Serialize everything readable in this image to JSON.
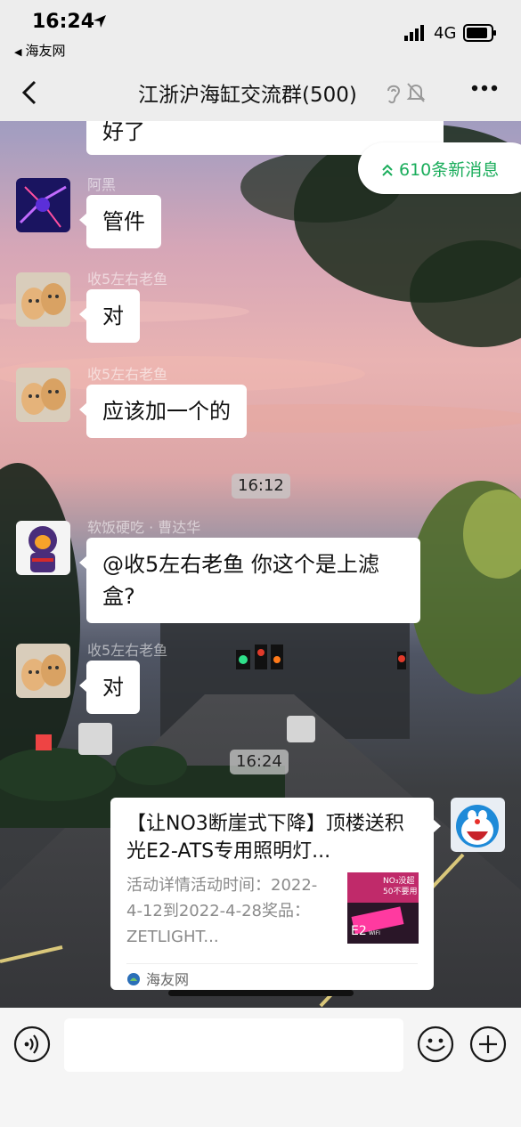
{
  "status": {
    "time": "16:24",
    "back_app": "海友网",
    "network": "4G"
  },
  "nav": {
    "title": "江浙沪海缸交流群(500)"
  },
  "new_messages": "610条新消息",
  "messages": [
    {
      "text": "好了"
    },
    {
      "sender": "阿黑",
      "text": "管件"
    },
    {
      "sender": "收5左右老鱼",
      "text": "对"
    },
    {
      "sender": "收5左右老鱼",
      "text": "应该加一个的"
    },
    {
      "sender": "软饭硬吃 · 曹达华",
      "text": "@收5左右老鱼 你这个是上滤盒?"
    },
    {
      "sender": "收5左右老鱼",
      "text": "对"
    }
  ],
  "timestamps": [
    "16:12",
    "16:24"
  ],
  "card": {
    "title": "【让NO3断崖式下降】顶楼送积光E2-ATS专用照明灯...",
    "desc": "活动详情活动时间：2022-4-12到2022-4-28奖品： ZETLIGHT...",
    "thumb_text_1": "NO₃没超",
    "thumb_text_2": "50不要用",
    "thumb_text_3": "E2",
    "thumb_text_4": "WIFI",
    "source": "海友网"
  },
  "input": {
    "placeholder": ""
  },
  "colors": {
    "accent_green": "#1aad5b",
    "bubble": "#ffffff",
    "nav_bg": "#ededed"
  }
}
